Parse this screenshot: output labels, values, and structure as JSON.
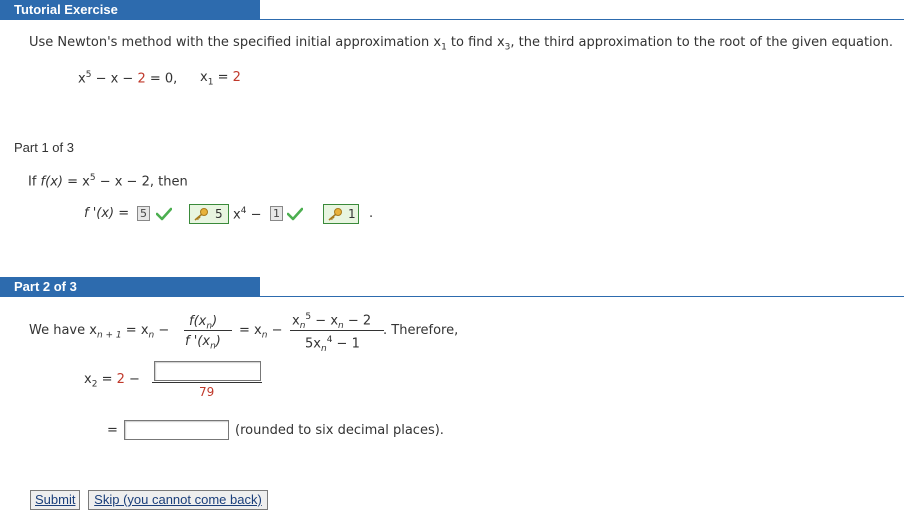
{
  "tutorial_header": "Tutorial Exercise",
  "problem": {
    "text_a": "Use Newton's method with the specified initial approximation ",
    "x1": "x",
    "x1_sub": "1",
    "text_b": " to find ",
    "x3": "x",
    "x3_sub": "3",
    "text_c": ", the third approximation to the root of the given equation.",
    "eq_x": "x",
    "eq_exp": "5",
    "eq_rest": " − x − ",
    "eq_two": "2",
    "eq_tail": " = 0,",
    "init_x": "x",
    "init_sub": "1",
    "init_eq": " = ",
    "init_val": "2"
  },
  "part1": {
    "label": "Part 1 of 3",
    "if_text": "If ",
    "fx": "f(x)",
    "eq_mid": " = x",
    "exp5": "5",
    "rest": " − x − 2,  then",
    "fprime": "f '(x) = ",
    "ans1": "5",
    "key1_value": "5",
    "x4_x": "x",
    "x4_exp": "4",
    "minus": " − ",
    "ans2": "1",
    "key2_value": "1",
    "period": "."
  },
  "part2": {
    "label": "Part 2 of 3",
    "we_have": "We have ",
    "xn1_x": "x",
    "xn1_sub": "n + 1",
    "eq_xn": " = x",
    "xn_sub": "n",
    "minus": " −",
    "frac1_num": "f(x",
    "frac1_num_sub": "n",
    "frac1_num_end": ")",
    "frac1_den": "f '(x",
    "frac1_den_sub": "n",
    "frac1_den_end": ")",
    "eq_xn2": "= x",
    "xn2_sub": "n",
    "minus2": " −",
    "frac2_num_x": "x",
    "frac2_num_sub": "n",
    "frac2_num_exp": "5",
    "frac2_num_mid": " − x",
    "frac2_num_sub2": "n",
    "frac2_num_end": " − 2",
    "frac2_den_a": "5x",
    "frac2_den_sub": "n",
    "frac2_den_exp": "4",
    "frac2_den_end": " − 1",
    "therefore": ". Therefore,",
    "x2_x": "x",
    "x2_sub": "2",
    "x2_eq": " = ",
    "x2_val": "2",
    "x2_minus": " −",
    "denominator": "79",
    "equals": "=",
    "note": "(rounded to six decimal places).",
    "numerator_input": "",
    "result_input": ""
  },
  "buttons": {
    "submit": "Submit",
    "skip": "Skip (you cannot come back)"
  },
  "colors": {
    "header_bg": "#2d6bae",
    "highlight_red": "#c0392b",
    "check_green": "#4caf50",
    "key_border": "#3a8a3a"
  }
}
